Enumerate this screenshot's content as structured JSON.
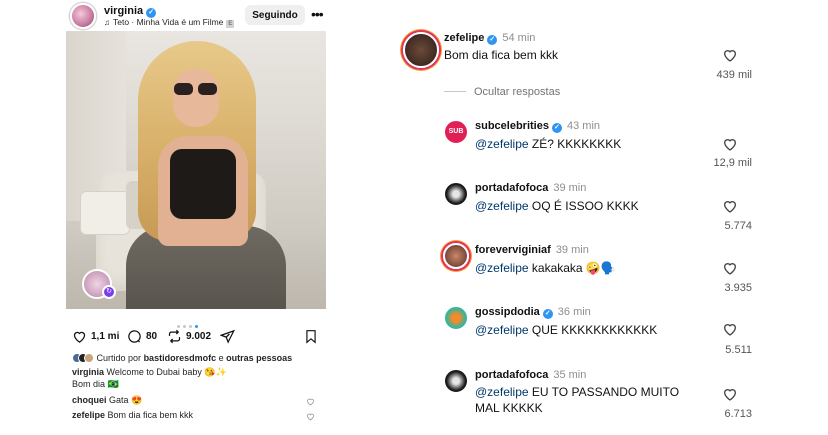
{
  "post": {
    "username": "virginia",
    "music": "Teto · Minha Vida é um Filme",
    "explicit_badge": "E",
    "follow_label": "Seguindo",
    "more_icon": "more-horizontal-icon",
    "carousel": {
      "total": 4,
      "active_index": 3
    },
    "likes_count": "1,1 mi",
    "comments_count": "80",
    "reposts_count": "9.002",
    "liked_by_prefix": "Curtido por",
    "liked_by_user": "bastidoresdmofc",
    "liked_by_conj": "e",
    "liked_by_suffix": "outras pessoas",
    "caption_user": "virginia",
    "caption_text": "Welcome to Dubai baby 😘✨",
    "caption_line2": "Bom dia 🇧🇷",
    "top_comments": [
      {
        "user": "choquei",
        "text": "Gata 😍"
      },
      {
        "user": "zefelipe",
        "text": "Bom dia fica bem kkk"
      }
    ]
  },
  "thread": {
    "main": {
      "user": "zefelipe",
      "time": "54 min",
      "text": "Bom dia fica bem kkk",
      "likes": "439 mil"
    },
    "hide_replies_label": "Ocultar respostas",
    "replies": [
      {
        "user": "subcelebrities",
        "verified": true,
        "time": "43 min",
        "mention": "@zefelipe",
        "text": "ZÉ? KKKKKKKK",
        "likes": "12,9 mil",
        "avatar_color": "#e01f56",
        "avatar_text": "SUB"
      },
      {
        "user": "portadafofoca",
        "verified": false,
        "time": "39 min",
        "mention": "@zefelipe",
        "text": "OQ É ISSOO KKKK",
        "likes": "5.774",
        "avatar_color": "#1b1b1b",
        "avatar_text": ""
      },
      {
        "user": "foreverviginiaf",
        "verified": false,
        "time": "39 min",
        "mention": "@zefelipe",
        "text": "kakakaka 🤪🗣️",
        "likes": "3.935",
        "avatar_color": "#8a4a30",
        "avatar_text": ""
      },
      {
        "user": "gossipdodia",
        "verified": true,
        "time": "36 min",
        "mention": "@zefelipe",
        "text": "QUE KKKKKKKKKKKK",
        "likes": "5.511",
        "avatar_color": "#3bb39a",
        "avatar_text": ""
      },
      {
        "user": "portadafofoca",
        "verified": false,
        "time": "35 min",
        "mention": "@zefelipe",
        "text": "EU TO PASSANDO MUITO",
        "text2": "MAL KKKKK",
        "likes": "6.713",
        "avatar_color": "#1b1b1b",
        "avatar_text": ""
      }
    ]
  },
  "colors": {
    "verified": "#2f95f0",
    "mention": "#00376b",
    "muted": "#8e8e8e"
  }
}
